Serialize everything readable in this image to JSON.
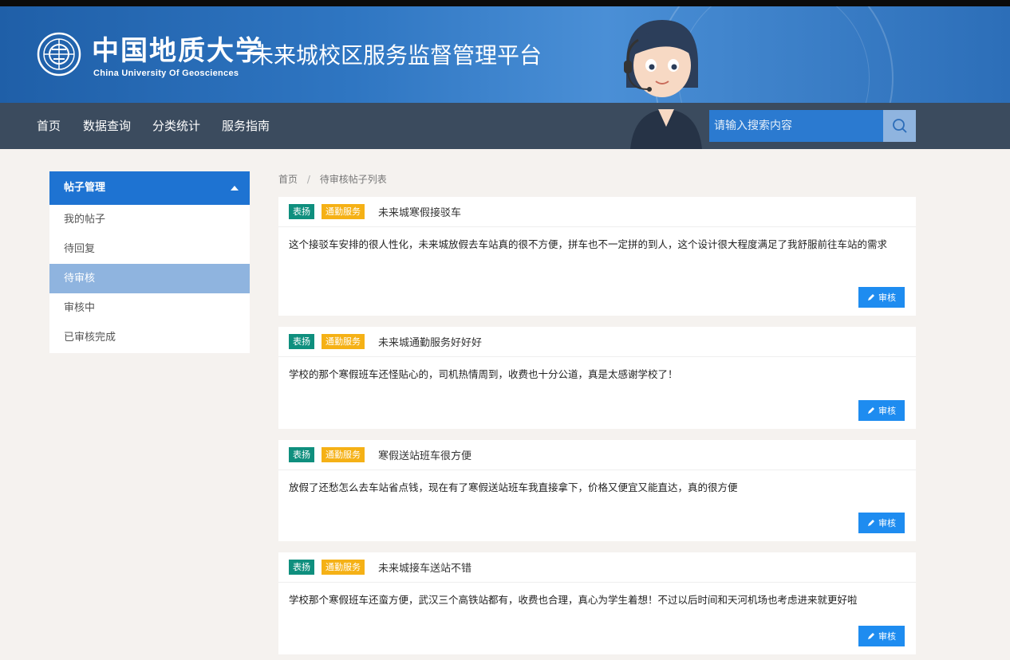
{
  "header": {
    "university_cn": "中国地质大学",
    "university_en": "China University Of Geosciences",
    "platform_title": "未来城校区服务监督管理平台"
  },
  "nav": {
    "items": [
      "首页",
      "数据查询",
      "分类统计",
      "服务指南"
    ],
    "search_placeholder": "请输入搜索内容"
  },
  "sidebar": {
    "header": "帖子管理",
    "items": [
      {
        "label": "我的帖子",
        "active": false
      },
      {
        "label": "待回复",
        "active": false
      },
      {
        "label": "待审核",
        "active": true
      },
      {
        "label": "审核中",
        "active": false
      },
      {
        "label": "已审核完成",
        "active": false
      }
    ]
  },
  "breadcrumb": {
    "home": "首页",
    "separator": "/",
    "current": "待审核帖子列表"
  },
  "posts": [
    {
      "tag_type": "表扬",
      "tag_category": "通勤服务",
      "title": "未来城寒假接驳车",
      "content": "这个接驳车安排的很人性化，未来城放假去车站真的很不方便，拼车也不一定拼的到人，这个设计很大程度满足了我舒服前往车站的需求",
      "button": "审核"
    },
    {
      "tag_type": "表扬",
      "tag_category": "通勤服务",
      "title": "未来城通勤服务好好好",
      "content": "学校的那个寒假班车还怪贴心的，司机热情周到，收费也十分公道，真是太感谢学校了！",
      "button": "审核"
    },
    {
      "tag_type": "表扬",
      "tag_category": "通勤服务",
      "title": "寒假送站班车很方便",
      "content": "放假了还愁怎么去车站省点钱，现在有了寒假送站班车我直接拿下，价格又便宜又能直达，真的很方便",
      "button": "审核"
    },
    {
      "tag_type": "表扬",
      "tag_category": "通勤服务",
      "title": "未来城接车送站不错",
      "content": "学校那个寒假班车还蛮方便，武汉三个高铁站都有，收费也合理，真心为学生着想！不过以后时间和天河机场也考虑进来就更好啦",
      "button": "审核"
    }
  ],
  "colors": {
    "primary": "#1e73d2",
    "nav_bg": "#3b4b5e",
    "tag_praise": "#0f8f7e",
    "tag_category": "#f5b116",
    "button": "#1e8cf0"
  }
}
